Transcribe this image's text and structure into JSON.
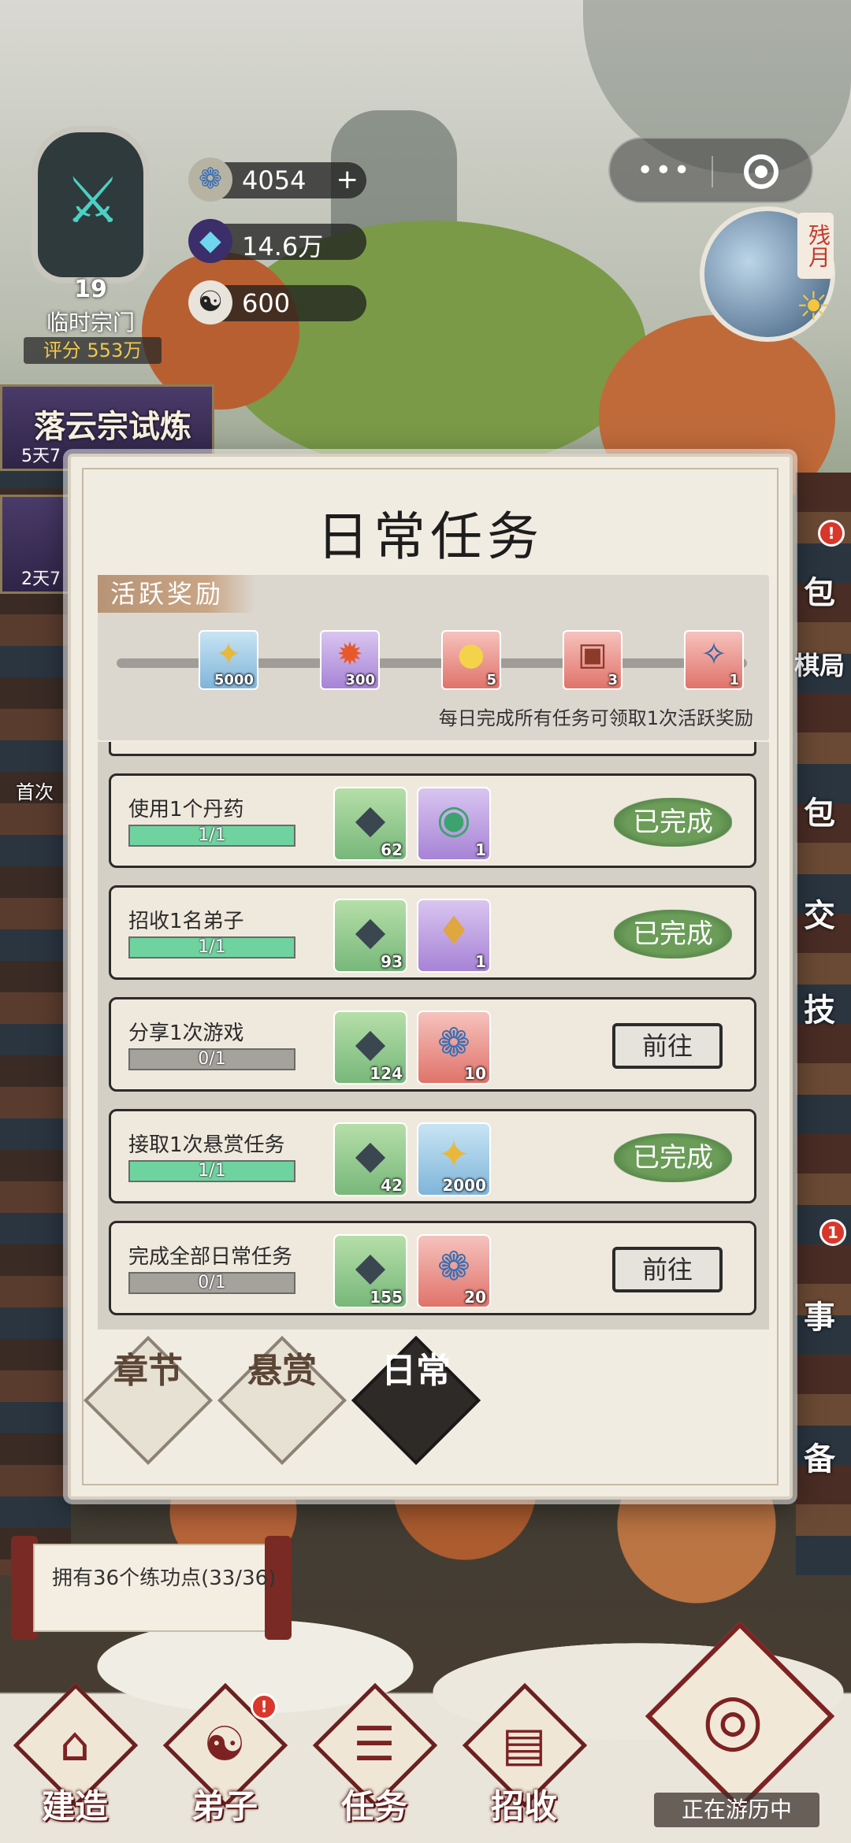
{
  "resources": {
    "spirit_stone": "4054",
    "crystal": "14.6万",
    "taiji": "600"
  },
  "sect": {
    "level": "19",
    "name": "临时宗门",
    "score_label": "评分",
    "score": "553万"
  },
  "moon_phase": "残月",
  "left_events": [
    {
      "title": "落云宗试炼",
      "time": "5天7"
    },
    {
      "title": "",
      "time": "2天7"
    }
  ],
  "left_labels": {
    "first_recharge": "首次"
  },
  "right_items": [
    "包",
    "棋局",
    "包",
    "交",
    "技",
    "事",
    "备"
  ],
  "modal": {
    "title": "日常任务",
    "active_tag": "活跃奖励",
    "hint": "每日完成所有任务可领取1次活跃奖励",
    "milestones": [
      {
        "icon": "gold-ingot-icon",
        "glyph": "✦",
        "count": "5000",
        "bg": "blue"
      },
      {
        "icon": "fire-stone-icon",
        "glyph": "✹",
        "count": "300",
        "bg": "purple"
      },
      {
        "icon": "pills-icon",
        "glyph": "●",
        "count": "5",
        "bg": "red"
      },
      {
        "icon": "chest-icon",
        "glyph": "▣",
        "count": "3",
        "bg": "red"
      },
      {
        "icon": "book-icon",
        "glyph": "✧",
        "count": "1",
        "bg": "red"
      }
    ],
    "tasks": [
      {
        "name": "使用1个丹药",
        "progress": "1/1",
        "progress_pct": 100,
        "rewards": [
          {
            "icon": "ore-icon",
            "glyph": "◆",
            "count": "62",
            "bg": "green"
          },
          {
            "icon": "orb-icon",
            "glyph": "◉",
            "count": "1",
            "bg": "purple"
          }
        ],
        "status": "done",
        "button": "已完成"
      },
      {
        "name": "招收1名弟子",
        "progress": "1/1",
        "progress_pct": 100,
        "rewards": [
          {
            "icon": "ore-icon",
            "glyph": "◆",
            "count": "93",
            "bg": "green"
          },
          {
            "icon": "token-icon",
            "glyph": "♦",
            "count": "1",
            "bg": "purple"
          }
        ],
        "status": "done",
        "button": "已完成"
      },
      {
        "name": "分享1次游戏",
        "progress": "0/1",
        "progress_pct": 0,
        "rewards": [
          {
            "icon": "ore-icon",
            "glyph": "◆",
            "count": "124",
            "bg": "green"
          },
          {
            "icon": "cloud-coin-icon",
            "glyph": "❁",
            "count": "10",
            "bg": "red"
          }
        ],
        "status": "go",
        "button": "前往"
      },
      {
        "name": "接取1次悬赏任务",
        "progress": "1/1",
        "progress_pct": 100,
        "rewards": [
          {
            "icon": "ore-icon",
            "glyph": "◆",
            "count": "42",
            "bg": "green"
          },
          {
            "icon": "gold-ingot-icon",
            "glyph": "✦",
            "count": "2000",
            "bg": "blue"
          }
        ],
        "status": "done",
        "button": "已完成"
      },
      {
        "name": "完成全部日常任务",
        "progress": "0/1",
        "progress_pct": 0,
        "rewards": [
          {
            "icon": "ore-icon",
            "glyph": "◆",
            "count": "155",
            "bg": "green"
          },
          {
            "icon": "cloud-coin-icon",
            "glyph": "❁",
            "count": "20",
            "bg": "red"
          }
        ],
        "status": "go",
        "button": "前往"
      }
    ],
    "tabs": [
      {
        "label": "章节",
        "active": false
      },
      {
        "label": "悬赏",
        "active": false
      },
      {
        "label": "日常",
        "active": true
      }
    ]
  },
  "training": {
    "text": "拥有36个练功点(33/36)"
  },
  "bottom_nav": [
    {
      "label": "建造",
      "glyph": "⌂"
    },
    {
      "label": "弟子",
      "glyph": "☯"
    },
    {
      "label": "任务",
      "glyph": "☰"
    },
    {
      "label": "招收",
      "glyph": "▤"
    }
  ],
  "travel": {
    "label": "正在游历中",
    "glyph": "◎"
  },
  "colors": {
    "done_green": "#6b9c58",
    "progress_green": "#6fd3a0",
    "badge_red": "#d9372b",
    "nav_red": "#7d2222"
  }
}
